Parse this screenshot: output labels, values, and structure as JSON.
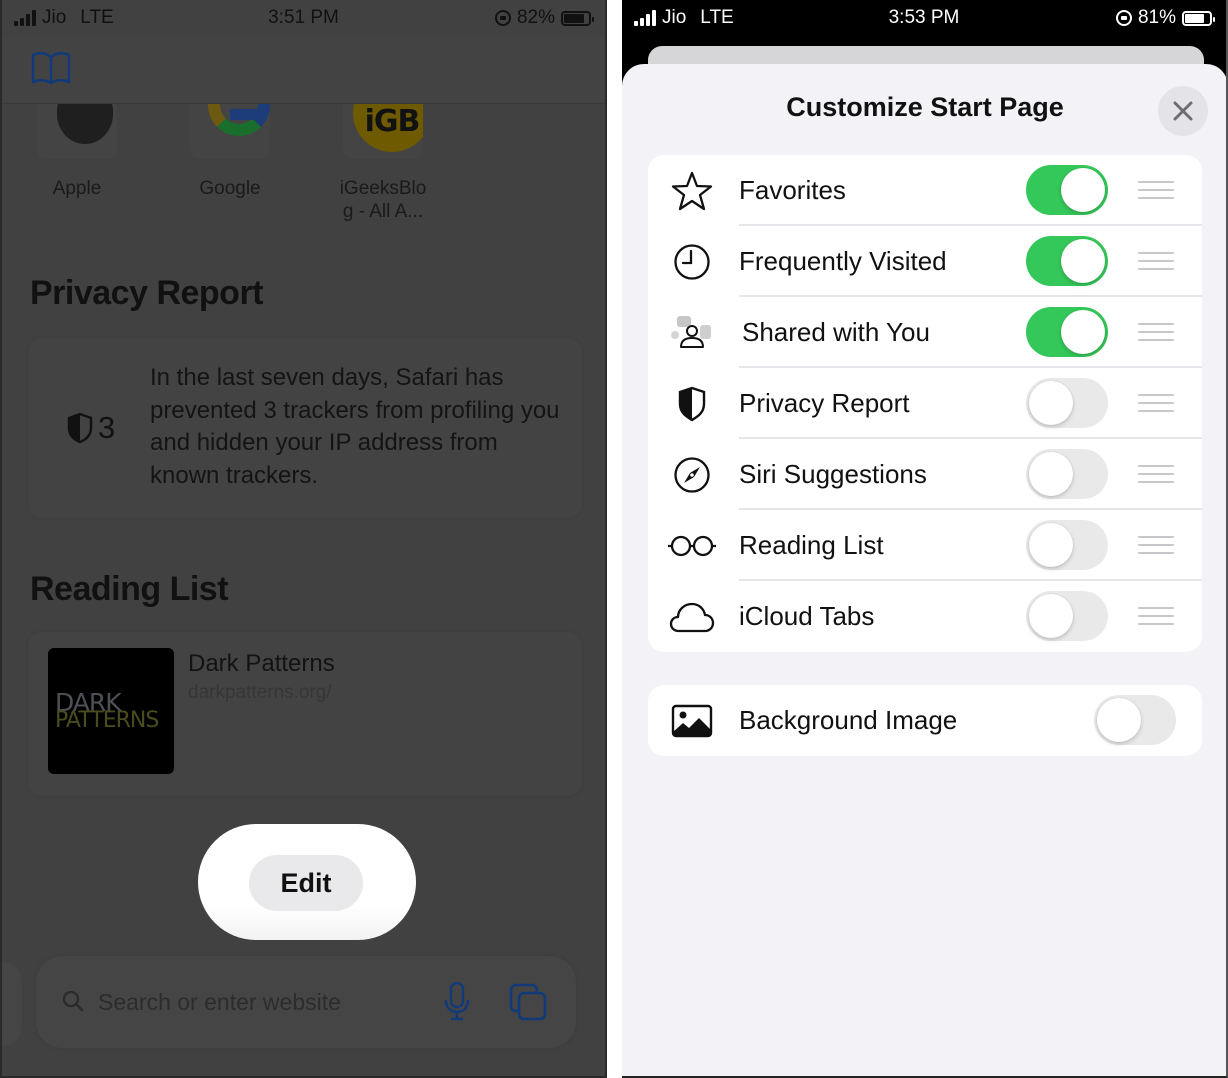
{
  "left_phone": {
    "status_bar": {
      "carrier": "Jio",
      "network": "LTE",
      "time": "3:51 PM",
      "battery": "82%",
      "battery_level": 0.82
    },
    "favorites": [
      {
        "label": "Apple",
        "icon": "apple-logo"
      },
      {
        "label": "Google",
        "icon": "google-logo"
      },
      {
        "label": "iGeeksBlo\ng - All A...",
        "icon": "igb-logo",
        "badge_text": "iGB"
      }
    ],
    "privacy_report": {
      "title": "Privacy Report",
      "tracker_count": "3",
      "text": "In the last seven days, Safari has prevented 3 trackers from profiling you and hidden your IP address from known trackers."
    },
    "reading_list": {
      "title": "Reading List",
      "items": [
        {
          "title": "Dark Patterns",
          "url": "darkpatterns.org/",
          "thumb_line1": "DARK",
          "thumb_line2": "PATTERNS"
        }
      ]
    },
    "edit_button": "Edit",
    "search": {
      "placeholder": "Search or enter website",
      "value": ""
    }
  },
  "right_phone": {
    "status_bar": {
      "carrier": "Jio",
      "network": "LTE",
      "time": "3:53 PM",
      "battery": "81%",
      "battery_level": 0.81
    },
    "sheet": {
      "title": "Customize Start Page",
      "close_label": "Close",
      "sections": [
        {
          "label": "Favorites",
          "icon": "star-icon",
          "enabled": true
        },
        {
          "label": "Frequently Visited",
          "icon": "clock-icon",
          "enabled": true
        },
        {
          "label": "Shared with You",
          "icon": "shared-with-you-icon",
          "enabled": true
        },
        {
          "label": "Privacy Report",
          "icon": "shield-icon",
          "enabled": false
        },
        {
          "label": "Siri Suggestions",
          "icon": "compass-icon",
          "enabled": false
        },
        {
          "label": "Reading List",
          "icon": "glasses-icon",
          "enabled": false
        },
        {
          "label": "iCloud Tabs",
          "icon": "cloud-icon",
          "enabled": false
        }
      ],
      "background_image": {
        "label": "Background Image",
        "icon": "photo-icon",
        "enabled": false
      }
    }
  },
  "colors": {
    "toggle_on": "#34c759",
    "toggle_off": "#e9e9ea",
    "sheet_bg": "#f2f2f7",
    "accent_blue": "#1c3d7a"
  }
}
